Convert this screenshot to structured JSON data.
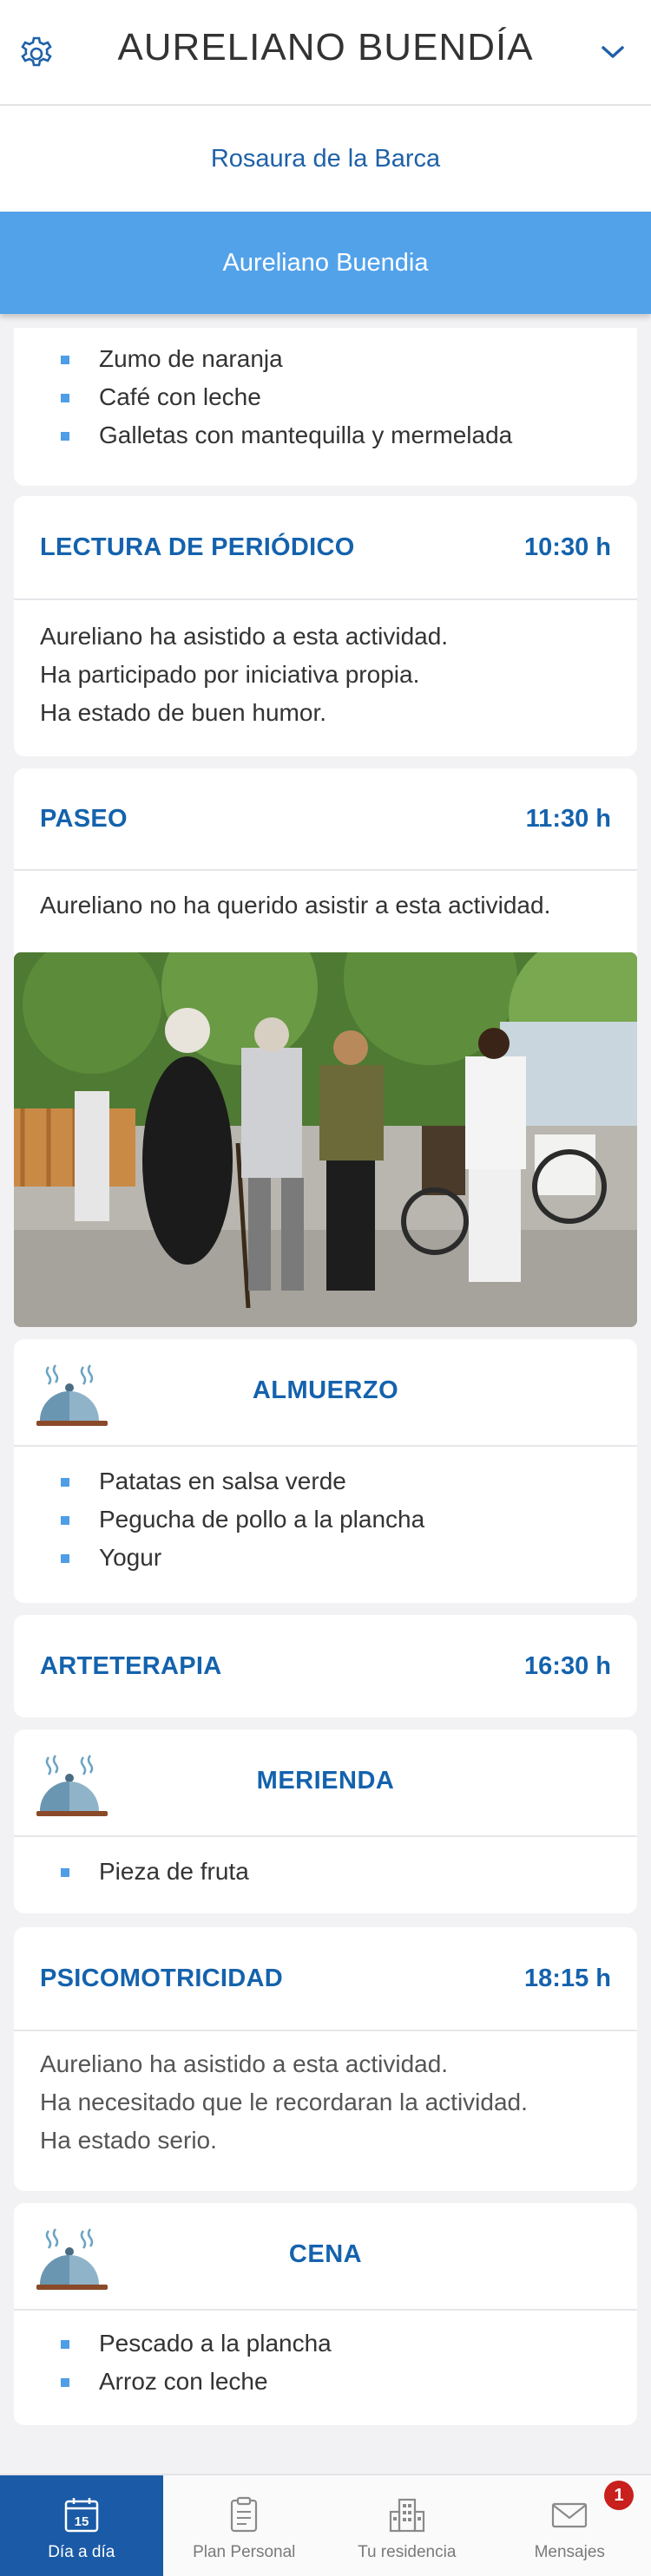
{
  "header": {
    "title": "AURELIANO BUENDÍA",
    "settings_icon": "gear-icon",
    "dropdown_icon": "chevron-down-icon"
  },
  "residents": [
    {
      "label": "Rosaura de la Barca",
      "active": false
    },
    {
      "label": "Aureliano Buendia",
      "active": true
    }
  ],
  "breakfast": {
    "items": [
      "Zumo de naranja",
      "Café con leche",
      "Galletas con mantequilla y mermelada"
    ]
  },
  "activities": {
    "lectura": {
      "title": "LECTURA DE PERIÓDICO",
      "time": "10:30 h",
      "lines": [
        "Aureliano ha asistido a esta actividad.",
        "Ha participado por iniciativa propia.",
        "Ha estado de buen humor."
      ]
    },
    "paseo": {
      "title": "PASEO",
      "time": "11:30 h",
      "lines": [
        "Aureliano no ha querido asistir a esta actividad."
      ]
    },
    "arteterapia": {
      "title": "ARTETERAPIA",
      "time": "16:30 h"
    },
    "psicomotricidad": {
      "title": "PSICOMOTRICIDAD",
      "time": "18:15 h",
      "lines": [
        "Aureliano ha asistido a esta actividad.",
        "Ha necesitado que le recordaran la actividad.",
        "Ha estado serio."
      ]
    }
  },
  "meals": {
    "almuerzo": {
      "title": "ALMUERZO",
      "items": [
        "Patatas en salsa verde",
        "Pegucha de pollo a la plancha",
        "Yogur"
      ]
    },
    "merienda": {
      "title": "MERIENDA",
      "items": [
        "Pieza de fruta"
      ]
    },
    "cena": {
      "title": "CENA",
      "items": [
        "Pescado a la plancha",
        "Arroz con leche"
      ]
    }
  },
  "tabbar": {
    "tabs": [
      {
        "label": "Día a día",
        "icon": "calendar-icon",
        "calendar_day": "15",
        "active": true
      },
      {
        "label": "Plan Personal",
        "icon": "clipboard-icon",
        "active": false
      },
      {
        "label": "Tu residencia",
        "icon": "building-icon",
        "active": false
      },
      {
        "label": "Mensajes",
        "icon": "envelope-icon",
        "active": false,
        "badge": "1"
      }
    ]
  },
  "colors": {
    "accent_blue": "#1462ad",
    "active_tab": "#52a2ea",
    "tabbar_active": "#1a5aa6",
    "badge_red": "#c8201d"
  }
}
